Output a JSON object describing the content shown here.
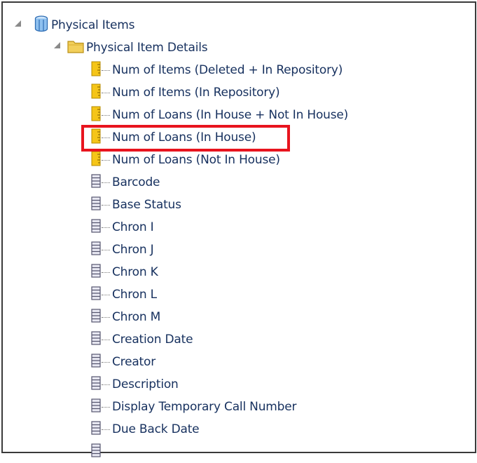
{
  "tree": {
    "root": {
      "label": "Physical Items",
      "icon": "cube-icon",
      "expanded": true
    },
    "folder": {
      "label": "Physical Item Details",
      "icon": "folder-icon",
      "expanded": true
    },
    "measures": [
      {
        "label": "Num of Items (Deleted + In Repository)",
        "icon": "measure-icon"
      },
      {
        "label": "Num of Items (In Repository)",
        "icon": "measure-icon"
      },
      {
        "label": "Num of Loans (In House + Not In House)",
        "icon": "measure-icon"
      },
      {
        "label": "Num of Loans (In House)",
        "icon": "measure-icon",
        "highlighted": true
      },
      {
        "label": "Num of Loans (Not In House)",
        "icon": "measure-icon"
      }
    ],
    "attributes": [
      {
        "label": "Barcode",
        "icon": "attribute-icon"
      },
      {
        "label": "Base Status",
        "icon": "attribute-icon"
      },
      {
        "label": "Chron I",
        "icon": "attribute-icon"
      },
      {
        "label": "Chron J",
        "icon": "attribute-icon"
      },
      {
        "label": "Chron K",
        "icon": "attribute-icon"
      },
      {
        "label": "Chron L",
        "icon": "attribute-icon"
      },
      {
        "label": "Chron M",
        "icon": "attribute-icon"
      },
      {
        "label": "Creation Date",
        "icon": "attribute-icon"
      },
      {
        "label": "Creator",
        "icon": "attribute-icon"
      },
      {
        "label": "Description",
        "icon": "attribute-icon"
      },
      {
        "label": "Display Temporary Call Number",
        "icon": "attribute-icon"
      },
      {
        "label": "Due Back Date",
        "icon": "attribute-icon"
      }
    ]
  },
  "colors": {
    "text": "#16305e",
    "highlight_border": "#e8141e",
    "frame_border": "#3a3a3a",
    "measure_icon": "#f5c518",
    "attribute_icon": "#6b6b8a",
    "folder_icon": "#f2cf5b"
  }
}
